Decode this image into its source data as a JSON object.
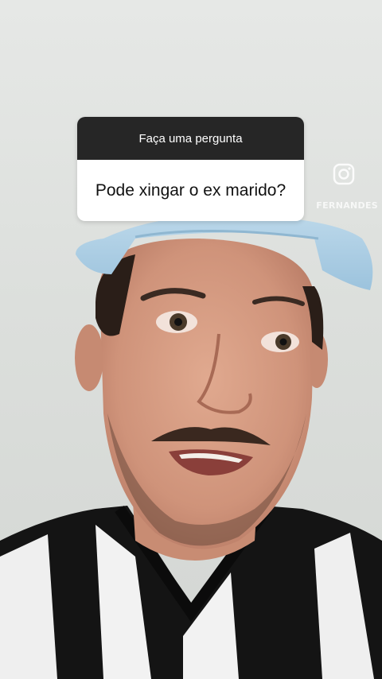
{
  "question_sticker": {
    "header": "Faça uma pergunta",
    "question": "Pode xingar o ex marido?"
  },
  "watermark": {
    "icon": "instagram-icon",
    "handle": "FERNANDES"
  },
  "colors": {
    "sticker_header_bg": "#262626",
    "sticker_body_bg": "#ffffff",
    "cap": "#a9cde4",
    "jersey_dark": "#141414",
    "jersey_light": "#f2f2f2"
  }
}
